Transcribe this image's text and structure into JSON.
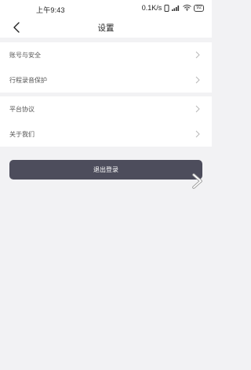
{
  "status_bar": {
    "time": "上午9:43",
    "network_speed": "0.1K/s",
    "battery_level": "92"
  },
  "nav": {
    "title": "设置",
    "back_icon": "chevron-left-icon"
  },
  "settings_groups": [
    {
      "items": [
        {
          "label": "账号与安全"
        },
        {
          "label": "行程录音保护"
        }
      ]
    },
    {
      "items": [
        {
          "label": "平台协议"
        },
        {
          "label": "关于我们"
        }
      ]
    }
  ],
  "logout": {
    "label": "退出登录",
    "background": "#4d4d5c"
  },
  "colors": {
    "page_background": "#f2f2f4",
    "row_text": "#555555",
    "chevron": "#b8b8b8"
  }
}
